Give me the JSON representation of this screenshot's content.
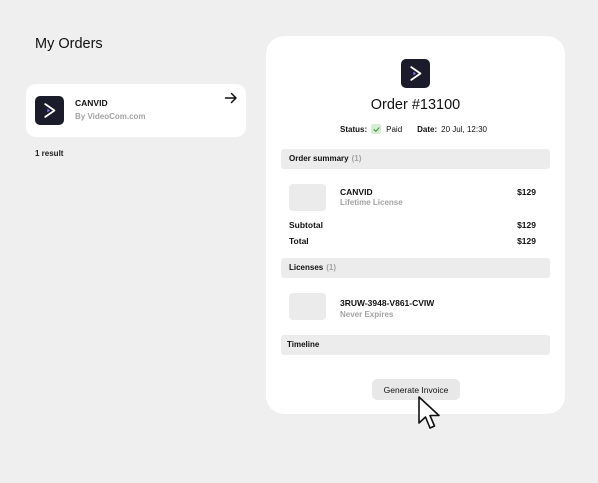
{
  "page": {
    "title": "My Orders"
  },
  "orders_list": {
    "items": [
      {
        "name": "CANVID",
        "vendor": "By VideoCom.com",
        "icon": "play-logo-icon",
        "action_icon": "arrow-right-icon"
      }
    ],
    "result_count": "1 result"
  },
  "order_detail": {
    "title": "Order #13100",
    "status_label": "Status:",
    "status_value": "Paid",
    "date_label": "Date:",
    "date_value": "20 Jul, 12:30",
    "summary": {
      "header": "Order summary",
      "count": "(1)",
      "item_name": "CANVID",
      "item_license": "Lifetime License",
      "item_price": "$129",
      "subtotal_label": "Subtotal",
      "subtotal_value": "$129",
      "total_label": "Total",
      "total_value": "$129"
    },
    "licenses": {
      "header": "Licenses",
      "count": "(1)",
      "key": "3RUW-3948-V861-CVIW",
      "expiry": "Never Expires"
    },
    "timeline": {
      "header": "Timeline"
    },
    "invoice_button": "Generate Invoice"
  },
  "colors": {
    "background": "#efefef",
    "card": "#ffffff",
    "app_icon_bg": "#1a1b2b",
    "muted_text": "#a3a3a3",
    "paid_badge": "#d7ecd5",
    "section_header_bg": "#ececec"
  }
}
